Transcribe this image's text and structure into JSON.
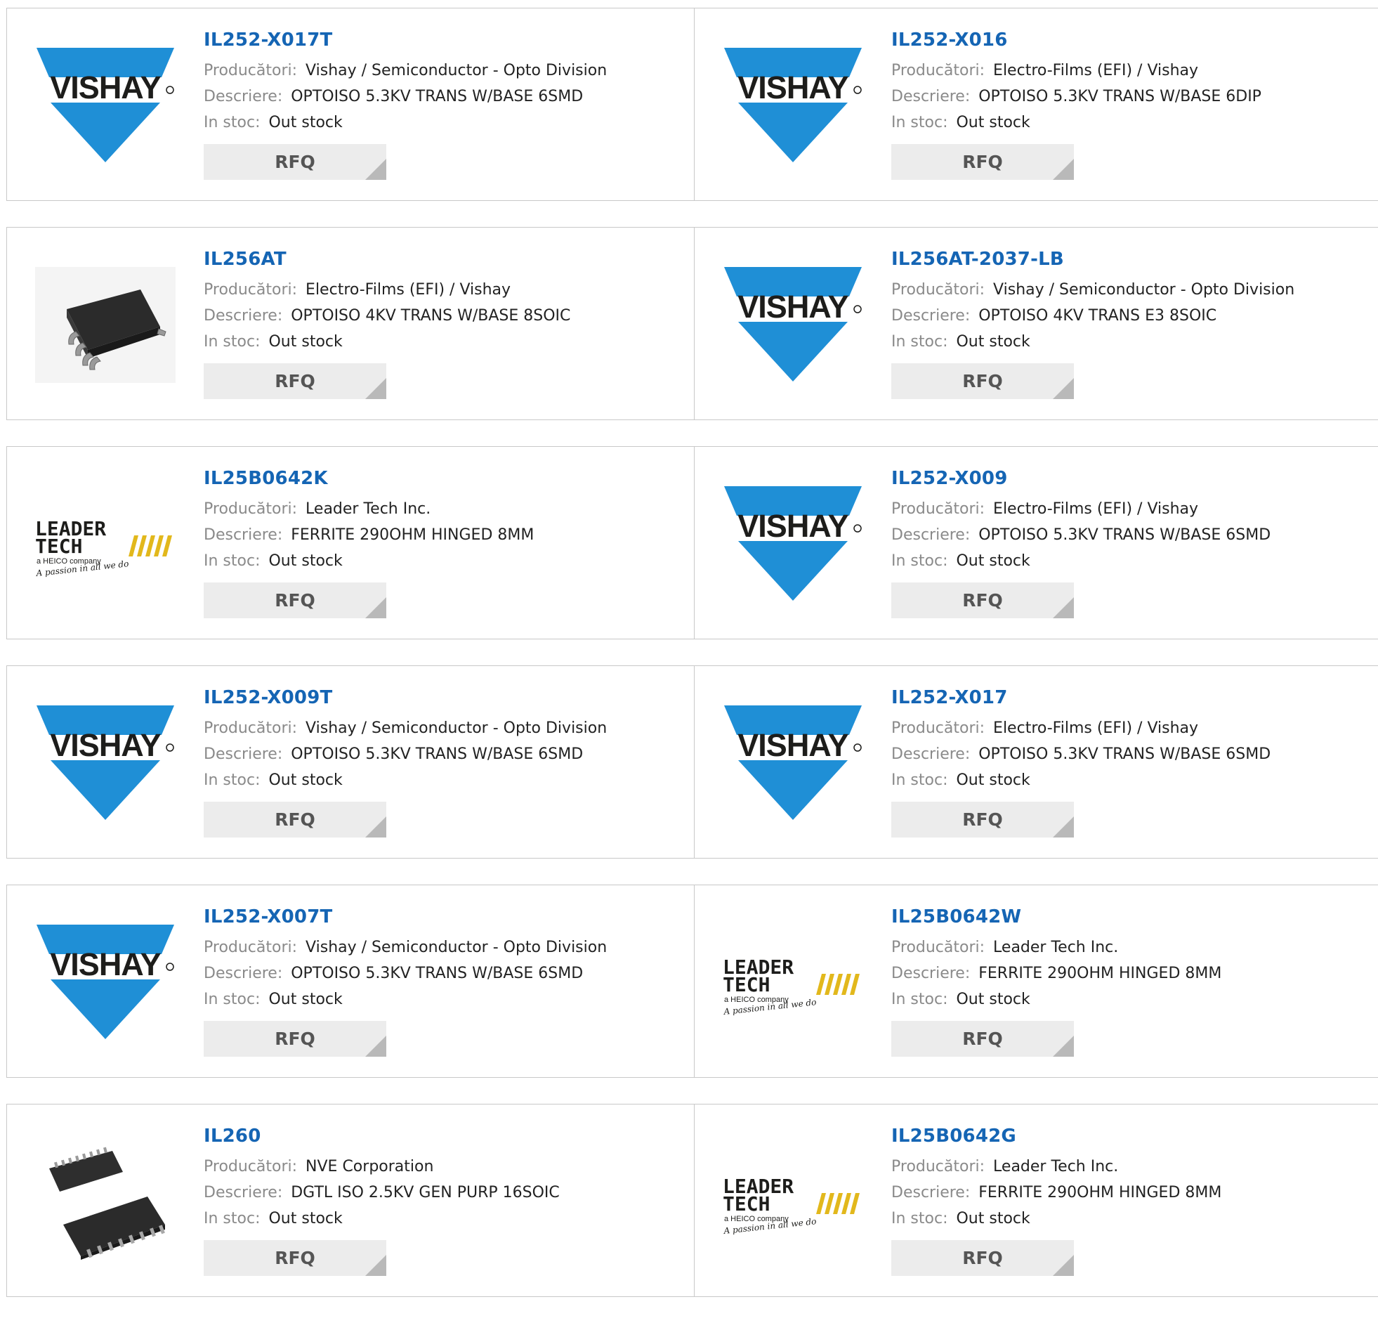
{
  "labels": {
    "manufacturer": "Producători:",
    "description": "Descriere:",
    "stock": "In stoc:",
    "rfq": "RFQ"
  },
  "logos": {
    "vishay_text": "VISHAY",
    "leader_line1": "LEADER",
    "leader_line2": "TECH",
    "leader_sub": "a HEICO company",
    "leader_slogan": "A passion in all we do"
  },
  "colors": {
    "part_link": "#1565b4",
    "vishay_blue": "#1f8fd6",
    "rfq_bg": "#ececec"
  },
  "products": [
    {
      "part": "IL252-X017T",
      "manufacturer": "Vishay / Semiconductor - Opto Division",
      "description": "OPTOISO 5.3KV TRANS W/BASE 6SMD",
      "stock": "Out stock",
      "logo": "vishay"
    },
    {
      "part": "IL252-X016",
      "manufacturer": "Electro-Films (EFI) / Vishay",
      "description": "OPTOISO 5.3KV TRANS W/BASE 6DIP",
      "stock": "Out stock",
      "logo": "vishay"
    },
    {
      "part": "IL256AT",
      "manufacturer": "Electro-Films (EFI) / Vishay",
      "description": "OPTOISO 4KV TRANS W/BASE 8SOIC",
      "stock": "Out stock",
      "logo": "chip-8soic"
    },
    {
      "part": "IL256AT-2037-LB",
      "manufacturer": "Vishay / Semiconductor - Opto Division",
      "description": "OPTOISO 4KV TRANS E3 8SOIC",
      "stock": "Out stock",
      "logo": "vishay"
    },
    {
      "part": "IL25B0642K",
      "manufacturer": "Leader Tech Inc.",
      "description": "FERRITE 290OHM HINGED 8MM",
      "stock": "Out stock",
      "logo": "leader-tech"
    },
    {
      "part": "IL252-X009",
      "manufacturer": "Electro-Films (EFI) / Vishay",
      "description": "OPTOISO 5.3KV TRANS W/BASE 6SMD",
      "stock": "Out stock",
      "logo": "vishay"
    },
    {
      "part": "IL252-X009T",
      "manufacturer": "Vishay / Semiconductor - Opto Division",
      "description": "OPTOISO 5.3KV TRANS W/BASE 6SMD",
      "stock": "Out stock",
      "logo": "vishay"
    },
    {
      "part": "IL252-X017",
      "manufacturer": "Electro-Films (EFI) / Vishay",
      "description": "OPTOISO 5.3KV TRANS W/BASE 6SMD",
      "stock": "Out stock",
      "logo": "vishay"
    },
    {
      "part": "IL252-X007T",
      "manufacturer": "Vishay / Semiconductor - Opto Division",
      "description": "OPTOISO 5.3KV TRANS W/BASE 6SMD",
      "stock": "Out stock",
      "logo": "vishay"
    },
    {
      "part": "IL25B0642W",
      "manufacturer": "Leader Tech Inc.",
      "description": "FERRITE 290OHM HINGED 8MM",
      "stock": "Out stock",
      "logo": "leader-tech"
    },
    {
      "part": "IL260",
      "manufacturer": "NVE Corporation",
      "description": "DGTL ISO 2.5KV GEN PURP 16SOIC",
      "stock": "Out stock",
      "logo": "chip-16soic"
    },
    {
      "part": "IL25B0642G",
      "manufacturer": "Leader Tech Inc.",
      "description": "FERRITE 290OHM HINGED 8MM",
      "stock": "Out stock",
      "logo": "leader-tech"
    }
  ]
}
